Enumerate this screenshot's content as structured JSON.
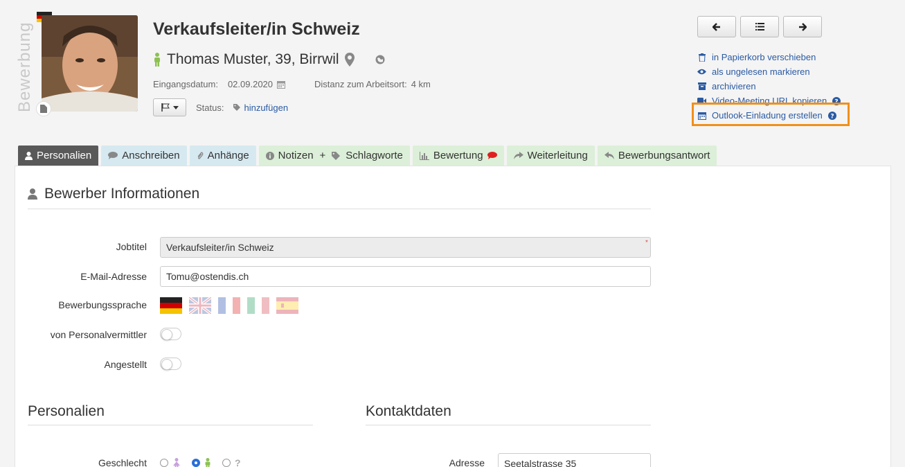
{
  "header": {
    "vertical_label": "Bewerbung",
    "job_title": "Verkaufsleiter/in Schweiz",
    "person": "Thomas Muster, 39, Birrwil",
    "received_label": "Eingangsdatum:",
    "received_date": "02.09.2020",
    "distance_label": "Distanz zum Arbeitsort:",
    "distance_value": "4 km",
    "status_label": "Status:",
    "status_add": "hinzufügen"
  },
  "actions": [
    {
      "icon": "trash-icon",
      "label": "in Papierkorb verschieben"
    },
    {
      "icon": "eye-icon",
      "label": "als ungelesen markieren"
    },
    {
      "icon": "archive-icon",
      "label": "archivieren"
    },
    {
      "icon": "video-camera-icon",
      "label": "Video-Meeting URL kopieren"
    },
    {
      "icon": "calendar-icon",
      "label": "Outlook-Einladung erstellen"
    }
  ],
  "tabs": [
    {
      "label": "Personalien",
      "icon": "user-icon"
    },
    {
      "label": "Anschreiben",
      "icon": "comment-icon"
    },
    {
      "label": "Anhänge",
      "icon": "paperclip-icon"
    },
    {
      "label": "Notizen",
      "icon": "info-icon"
    },
    {
      "label": "+",
      "icon": ""
    },
    {
      "label": "Schlagworte",
      "icon": "tags-icon"
    },
    {
      "label": "Bewertung",
      "icon": "bar-chart-icon"
    },
    {
      "label": "Weiterleitung",
      "icon": "share-icon"
    },
    {
      "label": "Bewerbungsantwort",
      "icon": "reply-icon"
    }
  ],
  "section": {
    "title": "Bewerber Informationen",
    "jobtitle_label": "Jobtitel",
    "jobtitle_value": "Verkaufsleiter/in Schweiz",
    "required_mark": "*",
    "email_label": "E-Mail-Adresse",
    "email_value": "Tomu@ostendis.ch",
    "language_label": "Bewerbungssprache",
    "agency_label": "von Personalvermittler",
    "employed_label": "Angestellt"
  },
  "personalien": {
    "title": "Personalien",
    "gender_label": "Geschlecht",
    "unknown_gender": "?"
  },
  "kontakt": {
    "title": "Kontaktdaten",
    "address_label": "Adresse",
    "address_value": "Seetalstrasse 35"
  },
  "colors": {
    "accent_link": "#2a5aa3",
    "highlight": "#f0901a",
    "male_icon": "#8cc152",
    "female_icon": "#c9a0dc",
    "comment_red": "#e02020"
  }
}
